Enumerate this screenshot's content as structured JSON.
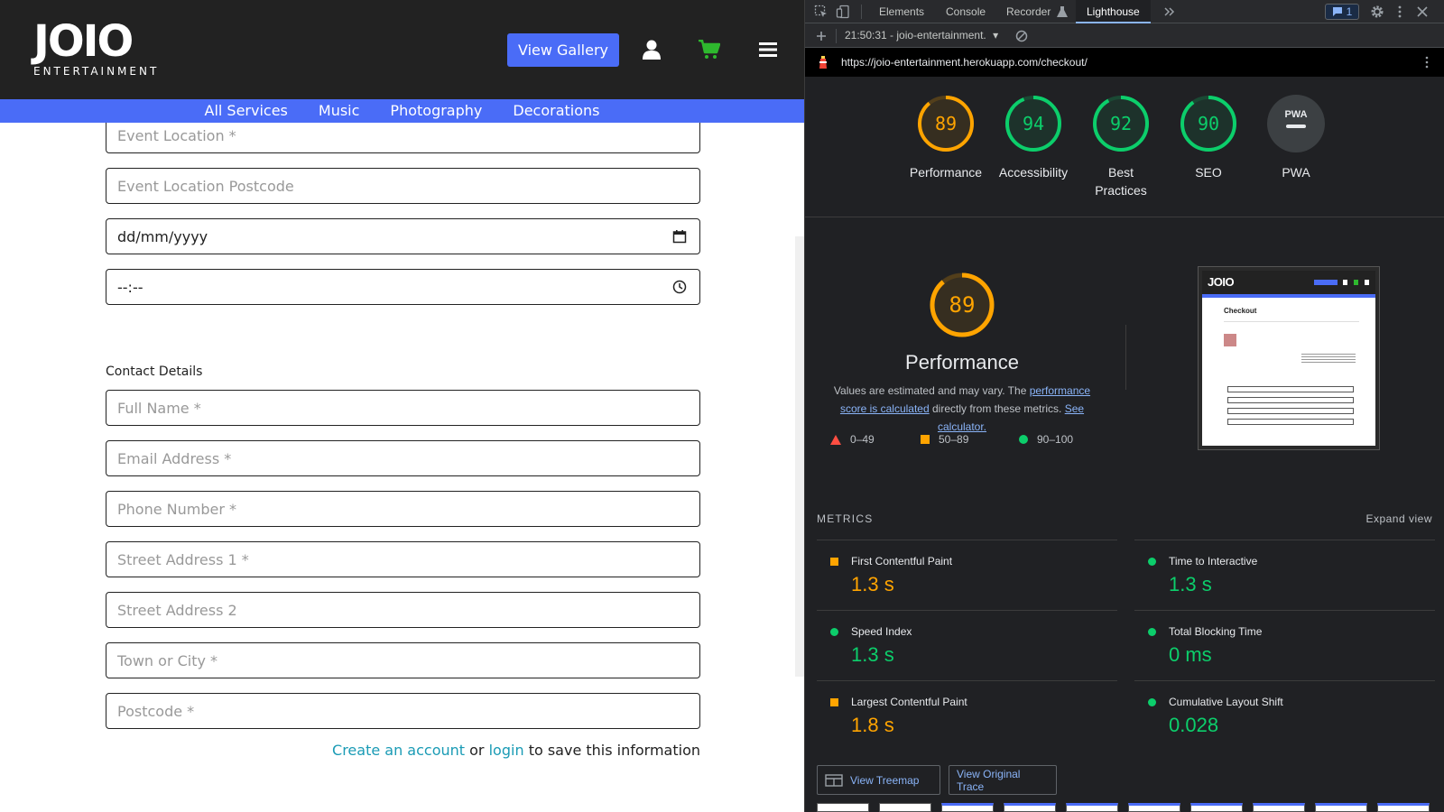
{
  "site": {
    "logo": {
      "main": "JOIO",
      "sub": "ENTERTAINMENT"
    },
    "header": {
      "gallery_button": "View Gallery",
      "icons": [
        "user-icon",
        "cart-icon",
        "menu-icon"
      ]
    },
    "nav": [
      "All Services",
      "Music",
      "Photography",
      "Decorations"
    ],
    "form": {
      "event_location": "Event Location *",
      "event_postcode": "Event Location Postcode",
      "date": "dd/mm/yyyy",
      "time": "--:--",
      "contact_title": "Contact Details",
      "full_name": "Full Name *",
      "email": "Email Address *",
      "phone": "Phone Number *",
      "street1": "Street Address 1 *",
      "street2": "Street Address 2",
      "town": "Town or City *",
      "postcode": "Postcode *",
      "create_account": "Create an account",
      "or": "or",
      "login": "login",
      "save_text": "to save this information"
    },
    "colors": {
      "header_bg": "#222222",
      "accent_blue": "#4a6cf7",
      "cart_green": "#2eb82e",
      "link_teal": "#1a9bb5"
    }
  },
  "devtools": {
    "tabs": [
      "Elements",
      "Console",
      "Recorder",
      "Lighthouse"
    ],
    "active_tab": "Lighthouse",
    "issues_count": "1",
    "report_select": "21:50:31 - joio-entertainment.",
    "url": "https://joio-entertainment.herokuapp.com/checkout/",
    "gauges": [
      {
        "label": "Performance",
        "score": "89",
        "color": "#ffa400",
        "value": 0.89
      },
      {
        "label": "Accessibility",
        "score": "94",
        "color": "#0cce6b",
        "value": 0.94
      },
      {
        "label": "Best Practices",
        "score": "92",
        "color": "#0cce6b",
        "value": 0.92
      },
      {
        "label": "SEO",
        "score": "90",
        "color": "#0cce6b",
        "value": 0.9
      },
      {
        "label": "PWA",
        "score": "PWA",
        "color": "#9aa0a6",
        "value": 0
      }
    ],
    "performance": {
      "score": "89",
      "title": "Performance",
      "desc_1": "Values are estimated and may vary. The ",
      "desc_link_1": "performance score is calculated",
      "desc_2": " directly from these metrics. ",
      "desc_link_2": "See calculator.",
      "legend": [
        "0–49",
        "50–89",
        "90–100"
      ]
    },
    "thumbnail": {
      "logo": "JOIO",
      "title": "Checkout"
    },
    "metrics_title": "METRICS",
    "expand_view": "Expand view",
    "metrics": [
      {
        "name": "First Contentful Paint",
        "value": "1.3 s",
        "status": "average"
      },
      {
        "name": "Time to Interactive",
        "value": "1.3 s",
        "status": "pass"
      },
      {
        "name": "Speed Index",
        "value": "1.3 s",
        "status": "pass"
      },
      {
        "name": "Total Blocking Time",
        "value": "0 ms",
        "status": "pass"
      },
      {
        "name": "Largest Contentful Paint",
        "value": "1.8 s",
        "status": "average"
      },
      {
        "name": "Cumulative Layout Shift",
        "value": "0.028",
        "status": "pass"
      }
    ],
    "buttons": {
      "treemap": "View Treemap",
      "trace": "View Original Trace"
    },
    "status_colors": {
      "fail": "#ff4e42",
      "average": "#ffa400",
      "pass": "#0cce6b"
    }
  }
}
